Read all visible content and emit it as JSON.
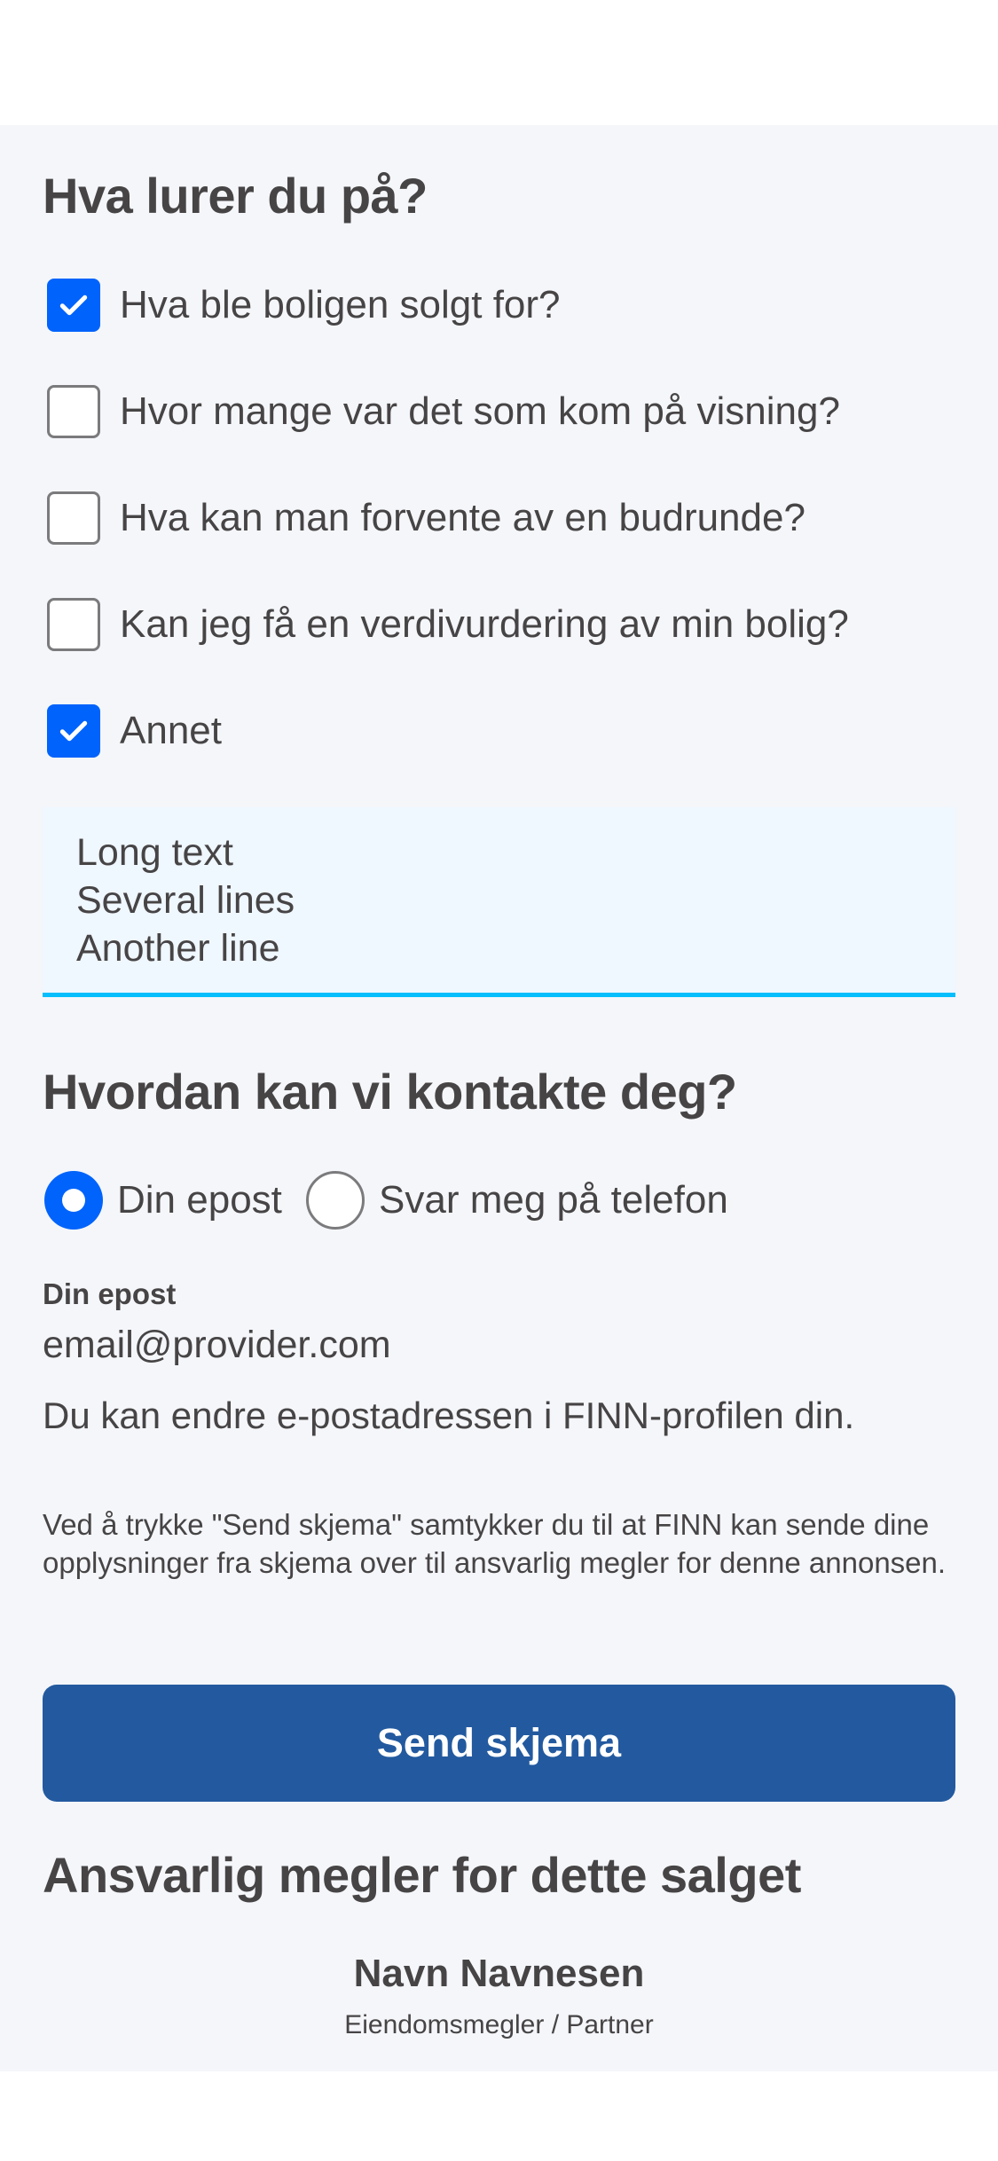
{
  "question_section": {
    "title": "Hva lurer du på?",
    "options": [
      {
        "label": "Hva ble boligen solgt for?",
        "checked": true
      },
      {
        "label": "Hvor mange var det som kom på visning?",
        "checked": false
      },
      {
        "label": "Hva kan man forvente av en budrunde?",
        "checked": false
      },
      {
        "label": "Kan jeg få en verdivurdering av min bolig?",
        "checked": false
      },
      {
        "label": "Annet",
        "checked": true
      }
    ],
    "other_text": {
      "lines": [
        "Long text",
        "Several lines",
        "Another line"
      ]
    }
  },
  "contact_section": {
    "title": "Hvordan kan vi kontakte deg?",
    "options": [
      {
        "label": "Din epost",
        "selected": true
      },
      {
        "label": "Svar meg på telefon",
        "selected": false
      }
    ],
    "email_label": "Din epost",
    "email_value": "email@provider.com",
    "email_help": "Du kan endre e-postadressen i FINN-profilen din."
  },
  "consent_text": "Ved å trykke \"Send skjema\" samtykker du til at FINN kan sende dine opplysninger fra skjema over til ansvarlig megler for denne annonsen.",
  "submit_label": "Send skjema",
  "broker_section": {
    "title": "Ansvarlig megler for dette salget",
    "name": "Navn Navnesen",
    "role": "Eiendomsmegler / Partner"
  },
  "colors": {
    "accent": "#0063fb",
    "button": "#235a9f",
    "focus_underline": "#06befb",
    "textarea_bg": "#eff7ff",
    "page_bg": "#f4f6fa",
    "text": "#474445"
  },
  "icons": {
    "checkbox_checked": "checkmark-icon",
    "radio_selected": "radio-dot-icon"
  }
}
